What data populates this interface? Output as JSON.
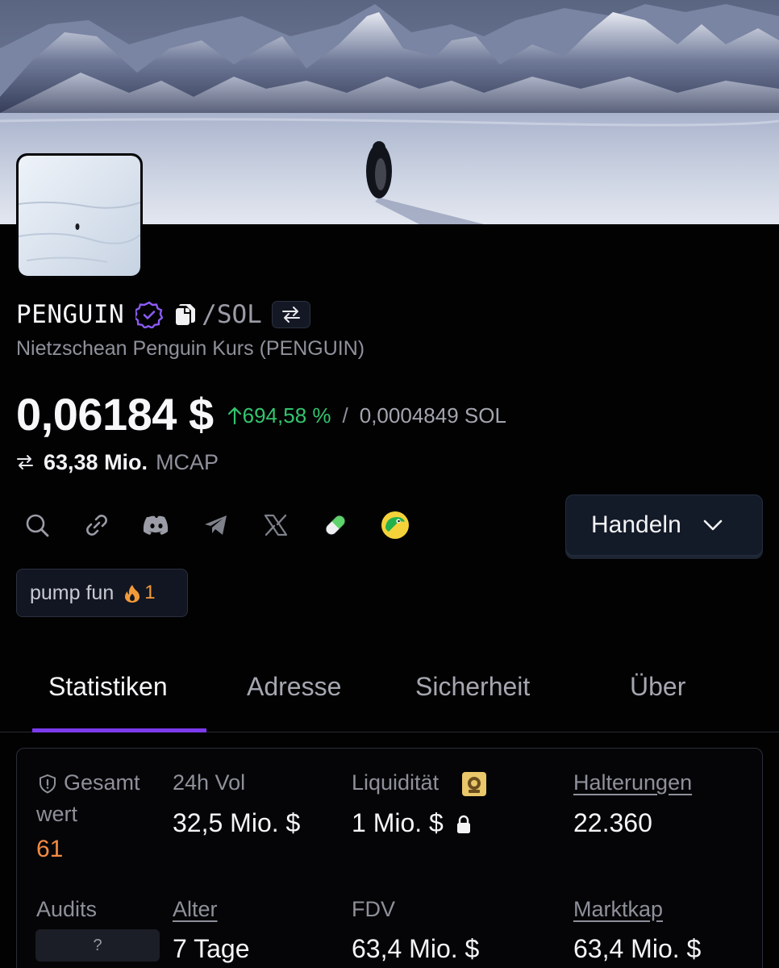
{
  "token": {
    "ticker": "PENGUIN",
    "pair_suffix": "/SOL",
    "subtitle": "Nietzschean Penguin Kurs (PENGUIN)"
  },
  "price": {
    "usd": "0,06184 $",
    "change": "694,58 %",
    "change_direction": "up",
    "separator": "/",
    "sol": "0,0004849 SOL"
  },
  "mcap": {
    "value": "63,38 Mio.",
    "label": "MCAP"
  },
  "links": [
    {
      "icon": "search-icon"
    },
    {
      "icon": "link-icon"
    },
    {
      "icon": "discord-icon"
    },
    {
      "icon": "telegram-icon"
    },
    {
      "icon": "x-icon"
    },
    {
      "icon": "pill-icon"
    },
    {
      "icon": "dexscreener-icon"
    }
  ],
  "trade_button": {
    "label": "Handeln"
  },
  "tag": {
    "label": "pump fun",
    "count": "1"
  },
  "tabs": [
    {
      "label": "Statistiken",
      "active": true
    },
    {
      "label": "Adresse",
      "active": false
    },
    {
      "label": "Sicherheit",
      "active": false
    },
    {
      "label": "Über",
      "active": false
    }
  ],
  "stats": {
    "total_score": {
      "label_line1": "Gesamt",
      "label_line2": "wert",
      "value": "61"
    },
    "vol24h": {
      "label": "24h Vol",
      "value": "32,5 Mio. $"
    },
    "liquidity": {
      "label": "Liquidität",
      "value": "1 Mio. $"
    },
    "holders": {
      "label": "Halterungen",
      "value": "22.360"
    },
    "audits": {
      "label": "Audits",
      "value": "?"
    },
    "age": {
      "label": "Alter",
      "value": "7 Tage"
    },
    "fdv": {
      "label": "FDV",
      "value": "63,4 Mio. $"
    },
    "marketcap": {
      "label": "Marktkap",
      "value": "63,4 Mio. $"
    }
  },
  "colors": {
    "accent": "#7c3aed",
    "positive": "#34c46e",
    "score": "#f28a44",
    "verified": "#8b5cf6"
  }
}
